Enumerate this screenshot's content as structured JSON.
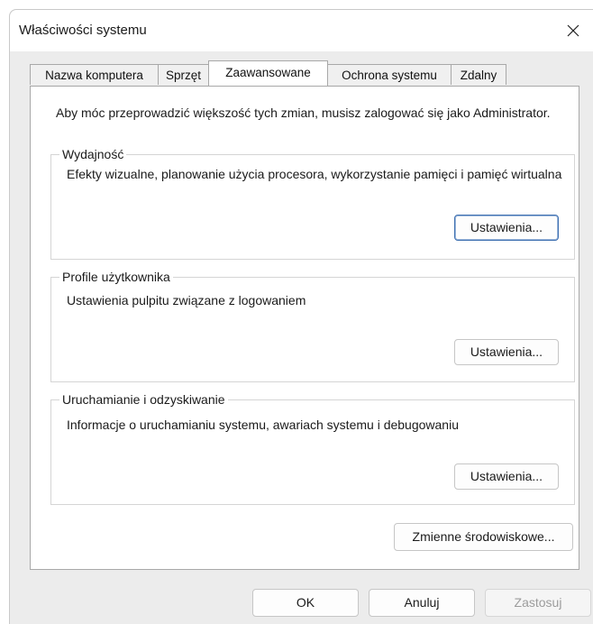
{
  "window": {
    "title": "Właściwości systemu"
  },
  "tabs": [
    {
      "label": "Nazwa komputera"
    },
    {
      "label": "Sprzęt"
    },
    {
      "label": "Zaawansowane",
      "active": true
    },
    {
      "label": "Ochrona systemu"
    },
    {
      "label": "Zdalny"
    }
  ],
  "intro": "Aby móc przeprowadzić większość tych zmian, musisz zalogować się jako Administrator.",
  "groups": {
    "performance": {
      "title": "Wydajność",
      "description": "Efekty wizualne, planowanie użycia procesora, wykorzystanie pamięci i pamięć wirtualna",
      "button": "Ustawienia..."
    },
    "profiles": {
      "title": "Profile użytkownika",
      "description": "Ustawienia pulpitu związane z logowaniem",
      "button": "Ustawienia..."
    },
    "startup": {
      "title": "Uruchamianie i odzyskiwanie",
      "description": "Informacje o uruchamianiu systemu, awariach systemu i debugowaniu",
      "button": "Ustawienia..."
    }
  },
  "env_button": "Zmienne środowiskowe...",
  "footer": {
    "ok": "OK",
    "cancel": "Anuluj",
    "apply": "Zastosuj"
  },
  "icons": {
    "close": "close-icon"
  }
}
